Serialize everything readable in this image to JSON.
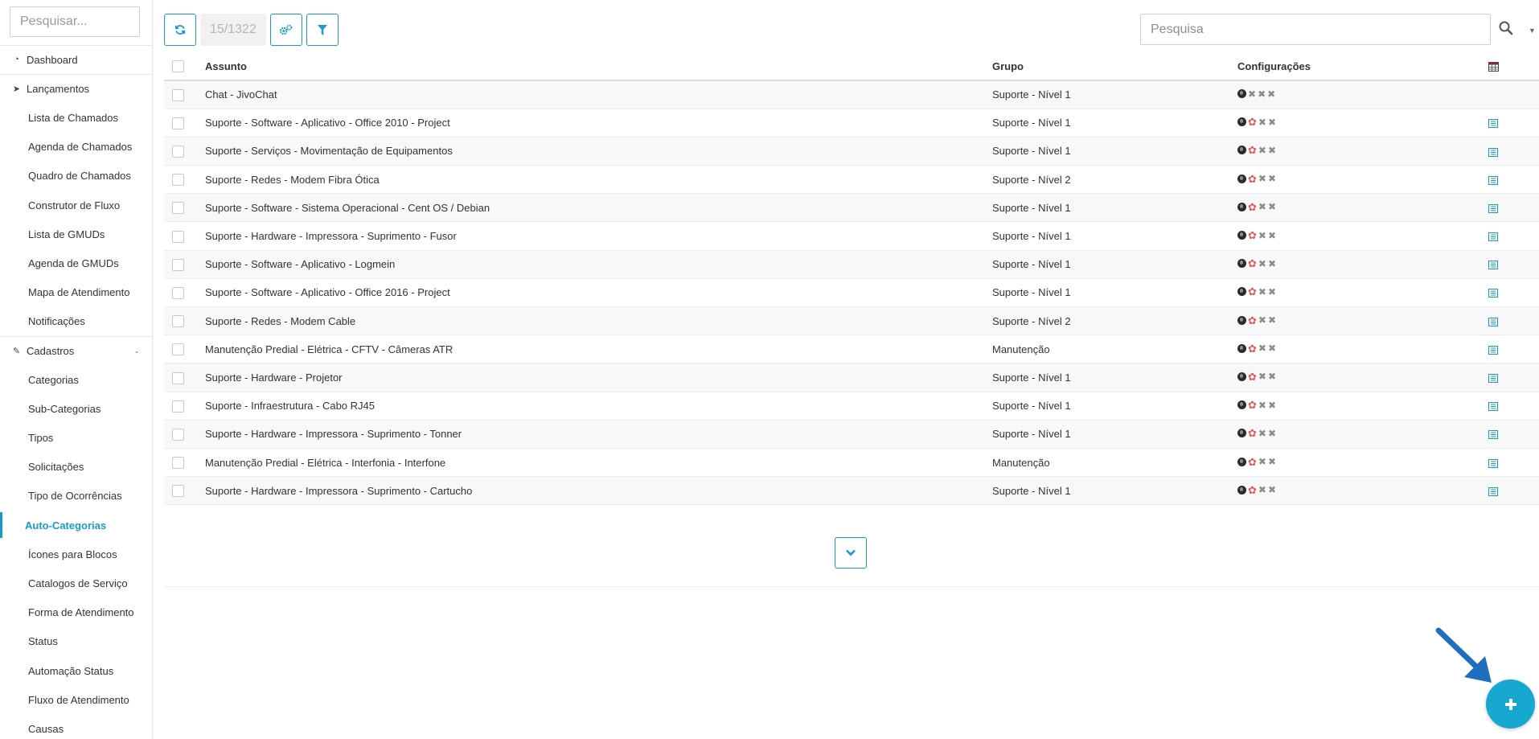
{
  "sidebar": {
    "search_placeholder": "Pesquisar...",
    "items": [
      {
        "label": "Dashboard",
        "kind": "top",
        "icon": "dashboard-icon"
      },
      {
        "label": "Lançamentos",
        "kind": "top",
        "icon": "location-arrow-icon"
      },
      {
        "label": "Lista de Chamados",
        "kind": "sub"
      },
      {
        "label": "Agenda de Chamados",
        "kind": "sub"
      },
      {
        "label": "Quadro de Chamados",
        "kind": "sub"
      },
      {
        "label": "Construtor de Fluxo",
        "kind": "sub"
      },
      {
        "label": "Lista de GMUDs",
        "kind": "sub"
      },
      {
        "label": "Agenda de GMUDs",
        "kind": "sub"
      },
      {
        "label": "Mapa de Atendimento",
        "kind": "sub"
      },
      {
        "label": "Notificações",
        "kind": "sub"
      },
      {
        "label": "Cadastros",
        "kind": "top",
        "icon": "edit-icon",
        "expanded": true
      },
      {
        "label": "Categorias",
        "kind": "sub"
      },
      {
        "label": "Sub-Categorias",
        "kind": "sub"
      },
      {
        "label": "Tipos",
        "kind": "sub"
      },
      {
        "label": "Solicitações",
        "kind": "sub"
      },
      {
        "label": "Tipo de Ocorrências",
        "kind": "sub"
      },
      {
        "label": "Auto-Categorias",
        "kind": "sub",
        "active": true
      },
      {
        "label": "Ícones para Blocos",
        "kind": "sub"
      },
      {
        "label": "Catalogos de Serviço",
        "kind": "sub"
      },
      {
        "label": "Forma de Atendimento",
        "kind": "sub"
      },
      {
        "label": "Status",
        "kind": "sub"
      },
      {
        "label": "Automação Status",
        "kind": "sub"
      },
      {
        "label": "Fluxo de Atendimento",
        "kind": "sub"
      },
      {
        "label": "Causas",
        "kind": "sub"
      }
    ]
  },
  "toolbar": {
    "refresh_icon": "refresh-icon",
    "count": "15/1322",
    "settings_icon": "cogs-icon",
    "filter_icon": "filter-icon"
  },
  "search": {
    "placeholder": "Pesquisa",
    "icon": "search-icon",
    "dropdown_icon": "caret-down-icon"
  },
  "table": {
    "columns": [
      "Assunto",
      "Grupo",
      "Configurações"
    ],
    "header_icon": "table-icon",
    "rows": [
      {
        "assunto": "Chat - JivoChat",
        "grupo": "Suporte - Nível 1",
        "users_icon": false,
        "action_icon": false
      },
      {
        "assunto": "Suporte - Software - Aplicativo - Office 2010 - Project",
        "grupo": "Suporte - Nível 1",
        "users_icon": true,
        "action_icon": true
      },
      {
        "assunto": "Suporte - Serviços - Movimentação de Equipamentos",
        "grupo": "Suporte - Nível 1",
        "users_icon": true,
        "action_icon": true
      },
      {
        "assunto": "Suporte - Redes - Modem Fibra Ótica",
        "grupo": "Suporte - Nível 2",
        "users_icon": true,
        "action_icon": true
      },
      {
        "assunto": "Suporte - Software - Sistema Operacional - Cent OS / Debian",
        "grupo": "Suporte - Nível 1",
        "users_icon": true,
        "action_icon": true
      },
      {
        "assunto": "Suporte - Hardware - Impressora - Suprimento - Fusor",
        "grupo": "Suporte - Nível 1",
        "users_icon": true,
        "action_icon": true
      },
      {
        "assunto": "Suporte - Software - Aplicativo - Logmein",
        "grupo": "Suporte - Nível 1",
        "users_icon": true,
        "action_icon": true
      },
      {
        "assunto": "Suporte - Software - Aplicativo - Office 2016 - Project",
        "grupo": "Suporte - Nível 1",
        "users_icon": true,
        "action_icon": true
      },
      {
        "assunto": "Suporte - Redes - Modem Cable",
        "grupo": "Suporte - Nível 2",
        "users_icon": true,
        "action_icon": true
      },
      {
        "assunto": "Manutenção Predial - Elétrica - CFTV - Câmeras ATR",
        "grupo": "Manutenção",
        "users_icon": true,
        "action_icon": true
      },
      {
        "assunto": "Suporte - Hardware - Projetor",
        "grupo": "Suporte - Nível 1",
        "users_icon": true,
        "action_icon": true
      },
      {
        "assunto": "Suporte - Infraestrutura - Cabo RJ45",
        "grupo": "Suporte - Nível 1",
        "users_icon": true,
        "action_icon": true
      },
      {
        "assunto": "Suporte - Hardware - Impressora - Suprimento - Tonner",
        "grupo": "Suporte - Nível 1",
        "users_icon": true,
        "action_icon": true
      },
      {
        "assunto": "Manutenção Predial - Elétrica - Interfonia - Interfone",
        "grupo": "Manutenção",
        "users_icon": true,
        "action_icon": true
      },
      {
        "assunto": "Suporte - Hardware - Impressora - Suprimento - Cartucho",
        "grupo": "Suporte - Nível 1",
        "users_icon": true,
        "action_icon": true
      }
    ]
  },
  "load_more": {
    "icon": "chevron-down-icon"
  },
  "fab": {
    "icon": "plus-icon"
  },
  "colors": {
    "accent": "#1a9bc7",
    "fab": "#17a8cf",
    "users_icon": "#e05a5a",
    "annotation_arrow": "#1f6fbf"
  }
}
